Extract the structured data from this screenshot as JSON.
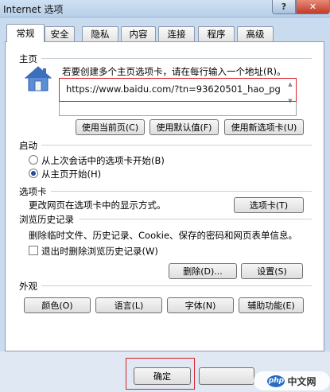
{
  "window": {
    "title": "Internet 选项",
    "help": "?",
    "close": "✕"
  },
  "tabs": [
    {
      "label": "常规",
      "active": true
    },
    {
      "label": "安全"
    },
    {
      "label": "隐私"
    },
    {
      "label": "内容"
    },
    {
      "label": "连接"
    },
    {
      "label": "程序"
    },
    {
      "label": "高级"
    }
  ],
  "homepage": {
    "group": "主页",
    "hint": "若要创建多个主页选项卡，请在每行输入一个地址(R)。",
    "url": "https://www.baidu.com/?tn=93620501_hao_pg",
    "buttons": {
      "use_current": "使用当前页(C)",
      "use_default": "使用默认值(F)",
      "use_new_tab": "使用新选项卡(U)"
    }
  },
  "startup": {
    "group": "启动",
    "option_last_session": "从上次会话中的选项卡开始(B)",
    "option_homepage": "从主页开始(H)",
    "selected": "homepage"
  },
  "tabs_section": {
    "group": "选项卡",
    "hint": "更改网页在选项卡中的显示方式。",
    "button": "选项卡(T)"
  },
  "history": {
    "group": "浏览历史记录",
    "hint": "删除临时文件、历史记录、Cookie、保存的密码和网页表单信息。",
    "checkbox": "退出时删除浏览历史记录(W)",
    "checked": false,
    "delete_button": "删除(D)...",
    "settings_button": "设置(S)"
  },
  "appearance": {
    "group": "外观",
    "colors": "颜色(O)",
    "languages": "语言(L)",
    "fonts": "字体(N)",
    "accessibility": "辅助功能(E)"
  },
  "footer": {
    "ok": "确定"
  },
  "watermark": {
    "logo": "php",
    "text": "中文网"
  },
  "colors": {
    "highlight": "#d8232a",
    "titlebar": "#b7cfe9"
  }
}
